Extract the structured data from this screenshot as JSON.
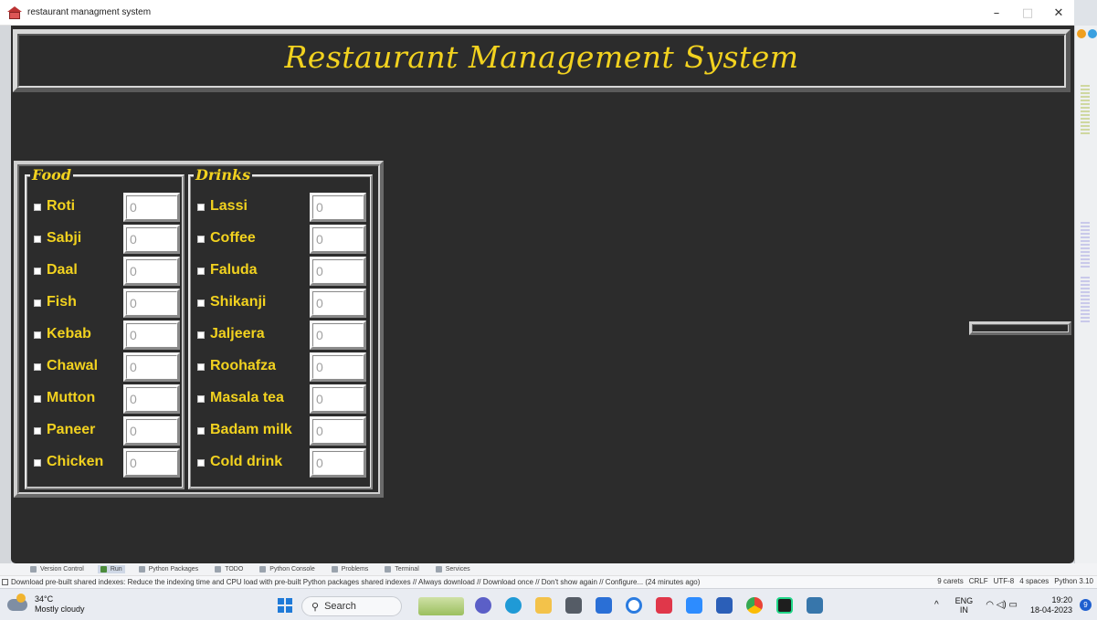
{
  "window": {
    "title": "restaurant managment system",
    "minimize_glyph": "–",
    "maximize_glyph": "□",
    "close_glyph": "✕"
  },
  "app": {
    "heading": "Restaurant Management System",
    "food": {
      "legend": "Food",
      "items": [
        {
          "label": "Roti",
          "value": "0"
        },
        {
          "label": "Sabji",
          "value": "0"
        },
        {
          "label": "Daal",
          "value": "0"
        },
        {
          "label": "Fish",
          "value": "0"
        },
        {
          "label": "Kebab",
          "value": "0"
        },
        {
          "label": "Chawal",
          "value": "0"
        },
        {
          "label": "Mutton",
          "value": "0"
        },
        {
          "label": "Paneer",
          "value": "0"
        },
        {
          "label": "Chicken",
          "value": "0"
        }
      ]
    },
    "drinks": {
      "legend": "Drinks",
      "items": [
        {
          "label": "Lassi",
          "value": "0"
        },
        {
          "label": "Coffee",
          "value": "0"
        },
        {
          "label": "Faluda",
          "value": "0"
        },
        {
          "label": "Shikanji",
          "value": "0"
        },
        {
          "label": "Jaljeera",
          "value": "0"
        },
        {
          "label": "Roohafza",
          "value": "0"
        },
        {
          "label": "Masala tea",
          "value": "0"
        },
        {
          "label": "Badam milk",
          "value": "0"
        },
        {
          "label": "Cold drink",
          "value": "0"
        }
      ]
    }
  },
  "ide": {
    "tools": [
      "Version Control",
      "Run",
      "Python Packages",
      "TODO",
      "Python Console",
      "Problems",
      "Terminal",
      "Services"
    ],
    "status_message": "Download pre-built shared indexes: Reduce the indexing time and CPU load with pre-built Python packages shared indexes // Always download // Download once // Don't show again // Configure... (24 minutes ago)",
    "status_right": [
      "9 carets",
      "CRLF",
      "UTF-8",
      "4 spaces",
      "Python 3.10"
    ]
  },
  "taskbar": {
    "weather_temp": "34°C",
    "weather_desc": "Mostly cloudy",
    "search_label": "Search",
    "lang_top": "ENG",
    "lang_bottom": "IN",
    "time": "19:20",
    "date": "18-04-2023",
    "notification_count": "9"
  },
  "colors": {
    "app_background": "#2c2c2c",
    "accent_yellow": "#f2d21f"
  }
}
